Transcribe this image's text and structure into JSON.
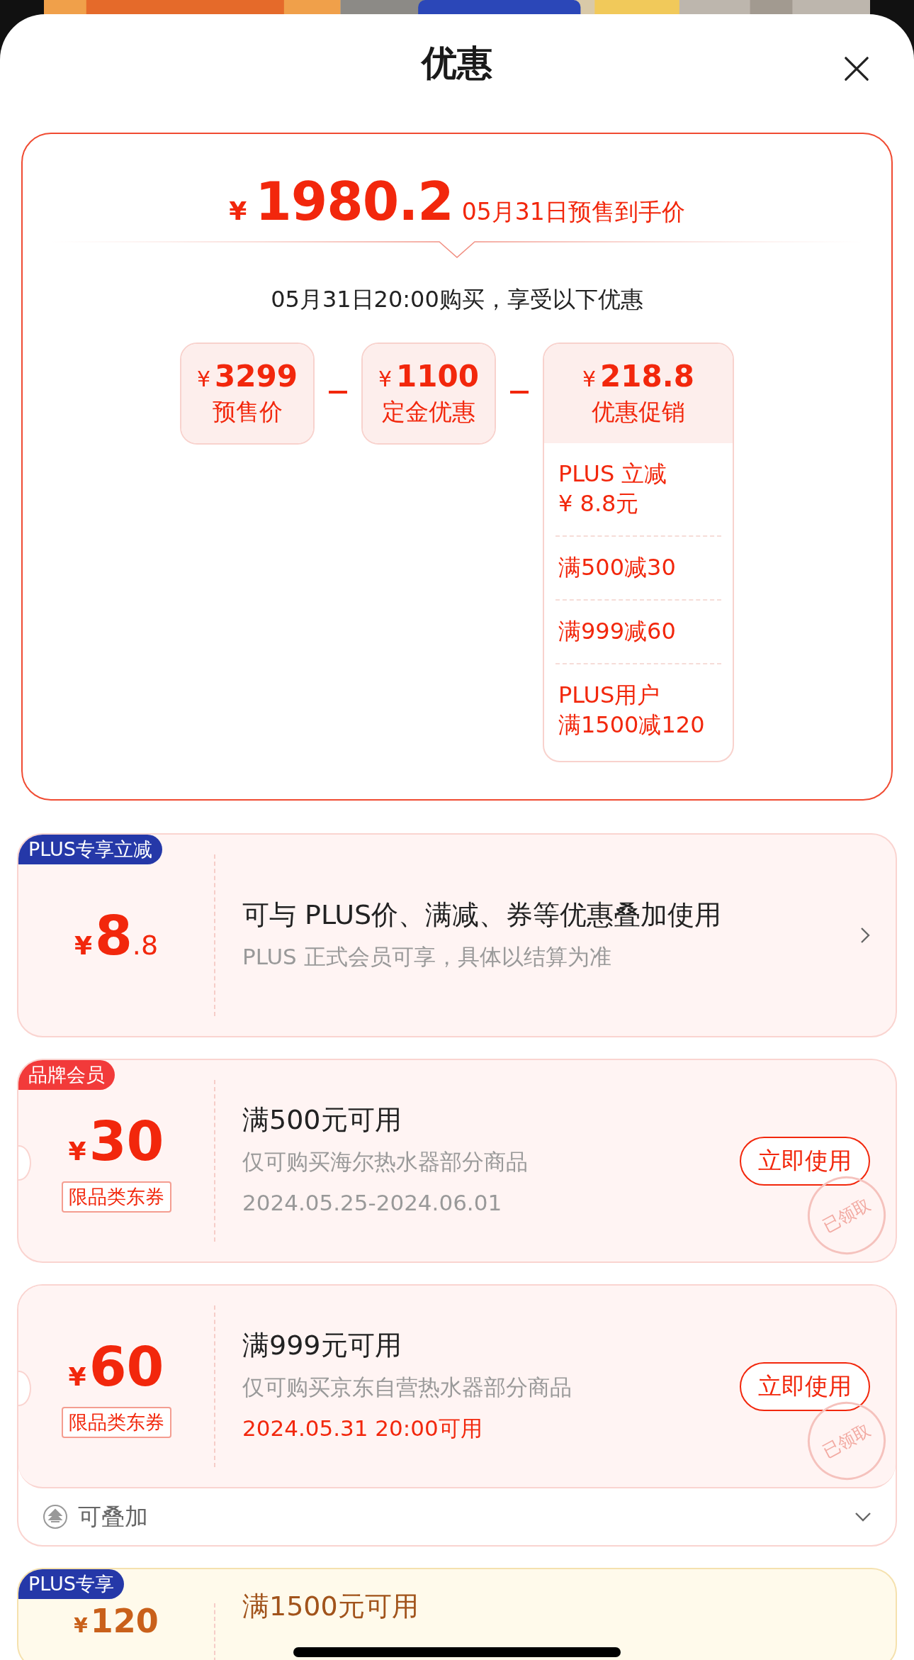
{
  "sheet": {
    "title": "优惠"
  },
  "summary": {
    "currency": "¥",
    "price": "1980.2",
    "price_note": "05月31日预售到手价",
    "purchase_note": "05月31日20:00购买，享受以下优惠",
    "breakdown": [
      {
        "currency": "¥",
        "amount": "3299",
        "label": "预售价"
      },
      {
        "currency": "¥",
        "amount": "1100",
        "label": "定金优惠"
      },
      {
        "currency": "¥",
        "amount": "218.8",
        "label": "优惠促销",
        "details": [
          {
            "lines": [
              "PLUS 立减",
              "¥ 8.8元"
            ]
          },
          {
            "lines": [
              "满500减30"
            ]
          },
          {
            "lines": [
              "满999减60"
            ]
          },
          {
            "lines": [
              "PLUS用户",
              "满1500减120"
            ]
          }
        ]
      }
    ]
  },
  "coupons": [
    {
      "kind": "plus-discount",
      "badge": "PLUS专享立减",
      "color": "#2538a8",
      "currency": "¥",
      "amount": "8",
      "decimal": ".8",
      "title": "可与 PLUS价、满减、券等优惠叠加使用",
      "subtitle": "PLUS 正式会员可享，具体以结算为准"
    },
    {
      "kind": "coupon",
      "badge": "品牌会员",
      "color": "#f23a3a",
      "currency": "¥",
      "amount": "30",
      "tag": "限品类东券",
      "title": "满500元可用",
      "subtitle": "仅可购买海尔热水器部分商品",
      "validity": "2024.05.25-2024.06.01",
      "validity_active": false,
      "button": "立即使用",
      "stamp": "已领取"
    },
    {
      "kind": "coupon",
      "currency": "¥",
      "amount": "60",
      "tag": "限品类东券",
      "title": "满999元可用",
      "subtitle": "仅可购买京东自营热水器部分商品",
      "validity": "2024.05.31 20:00可用",
      "validity_active": true,
      "button": "立即使用",
      "stamp": "已领取",
      "footer": {
        "label": "可叠加",
        "expanded": false
      }
    },
    {
      "kind": "plus-coupon",
      "badge": "PLUS专享",
      "color": "#2538a8",
      "currency": "¥",
      "amount": "120",
      "title": "满1500元可用"
    }
  ]
}
